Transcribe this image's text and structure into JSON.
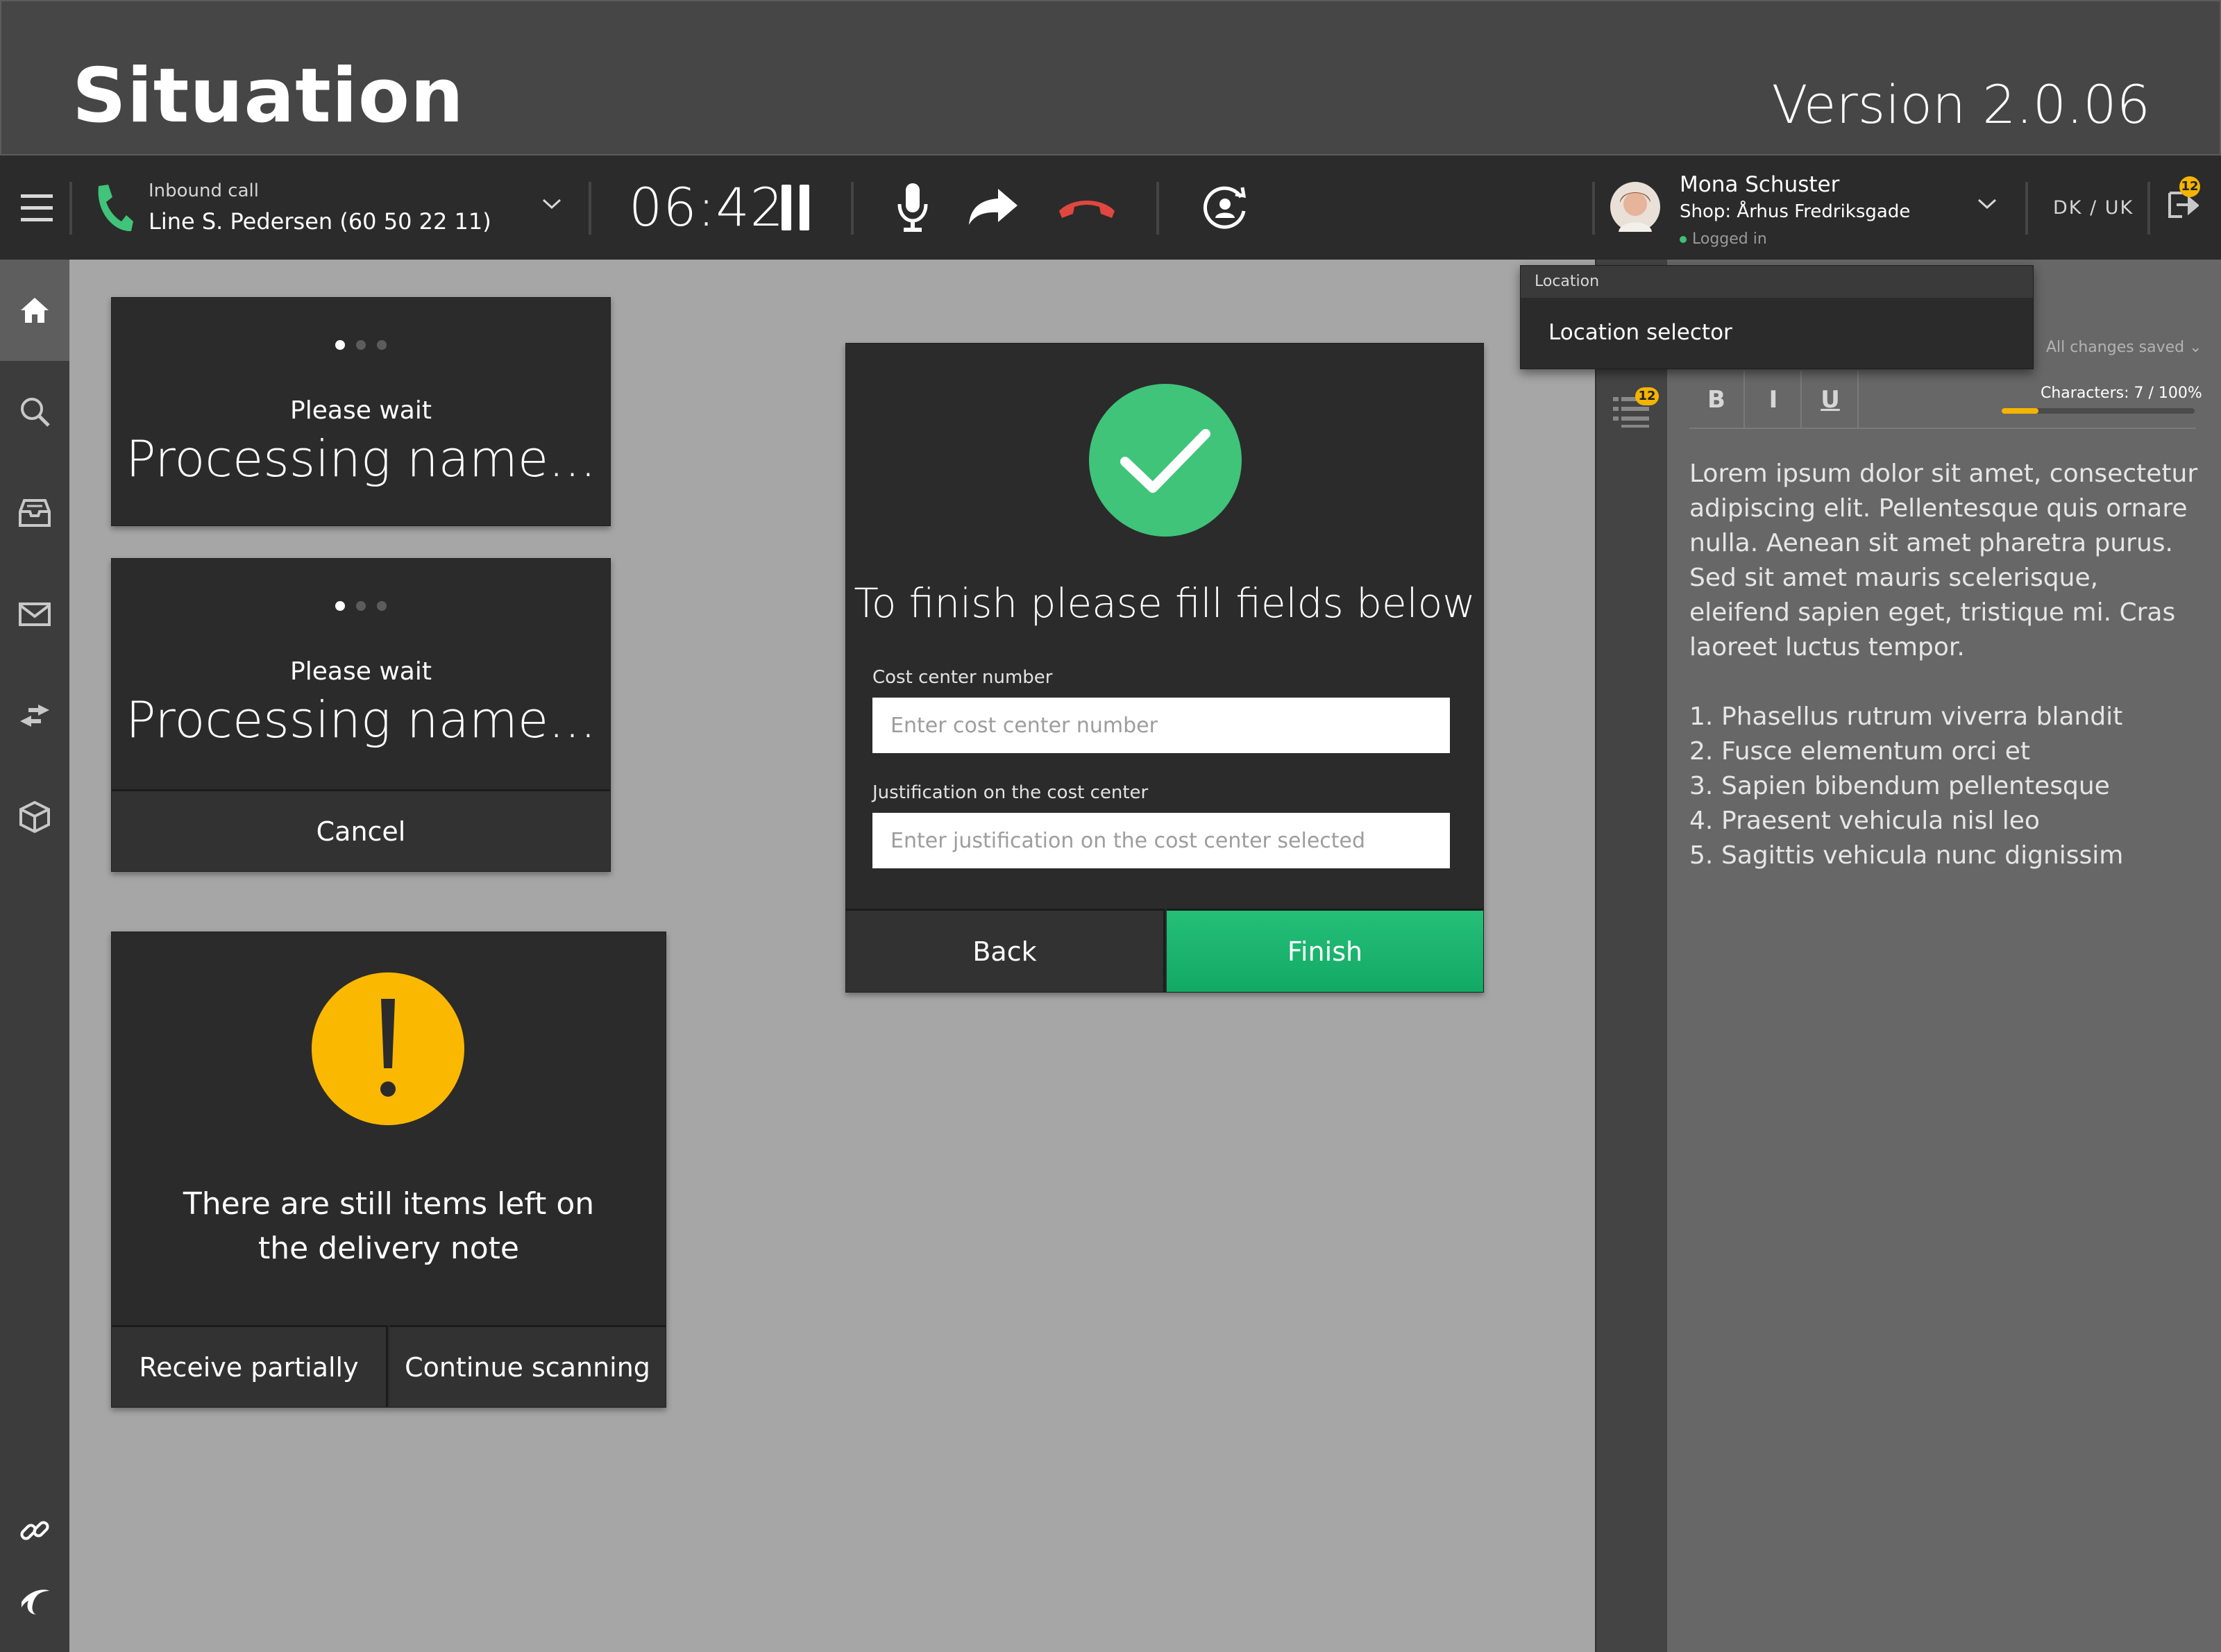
{
  "header": {
    "title": "Situation",
    "version": "Version 2.0.06"
  },
  "toolbar": {
    "call_type": "Inbound call",
    "caller": "Line S. Pedersen (60 50 22 11)",
    "timer": "06:42",
    "user_name": "Mona Schuster",
    "user_shop": "Shop: Århus Fredriksgade",
    "user_status": "Logged in",
    "lang": "DK  /  UK",
    "notification_count": "12"
  },
  "location_dropdown": {
    "header": "Location",
    "item": "Location selector"
  },
  "processing_card_1": {
    "wait": "Please wait",
    "status": "Processing name..."
  },
  "processing_card_2": {
    "wait": "Please wait",
    "status": "Processing name...",
    "cancel": "Cancel"
  },
  "warning_card": {
    "message_line1": "There are still items left  on",
    "message_line2": "the delivery note",
    "receive_partially": "Receive partially",
    "continue_scanning": "Continue scanning"
  },
  "finish_dialog": {
    "heading": "To finish please fill fields below",
    "cost_center_label": "Cost center number",
    "cost_center_placeholder": "Enter cost center number",
    "justification_label": "Justification on the cost center",
    "justification_placeholder": "Enter justification on the cost center selected",
    "back": "Back",
    "finish": "Finish"
  },
  "editor": {
    "saved_status": "All changes saved",
    "bold": "B",
    "italic": "I",
    "underline": "U",
    "characters": "Characters: 7 / 100%",
    "char_progress": 0.19,
    "notes_badge": "12",
    "body": "Lorem ipsum dolor sit amet, consectetur adipiscing elit. Pellentesque quis ornare nulla. Aenean sit amet pharetra purus. Sed sit amet mauris scelerisque, eleifend sapien eget, tristique mi. Cras laoreet luctus tempor.",
    "list": [
      {
        "num": "1.",
        "text": "Phasellus rutrum viverra blandit"
      },
      {
        "num": "2.",
        "text": "Fusce elementum orci et"
      },
      {
        "num": "3.",
        "text": "Sapien bibendum pellentesque"
      },
      {
        "num": "4.",
        "text": "Praesent vehicula nisl leo"
      },
      {
        "num": "5.",
        "text": "Sagittis vehicula nunc dignissim"
      }
    ]
  },
  "colors": {
    "success": "#3fc47a",
    "finish_button": "#19b46e",
    "warning": "#fbb800",
    "hangup": "#e0473f",
    "accent_yellow": "#f4b400"
  },
  "icons": [
    "menu-icon",
    "phone-icon",
    "chevron-down-icon",
    "pause-icon",
    "microphone-icon",
    "forward-icon",
    "hangup-icon",
    "user-refresh-icon",
    "avatar",
    "logout-icon",
    "home-icon",
    "search-icon",
    "archive-icon",
    "mail-icon",
    "transfer-icon",
    "box-icon",
    "link-icon",
    "brand-icon",
    "list-icon",
    "check-icon",
    "exclamation-icon"
  ]
}
